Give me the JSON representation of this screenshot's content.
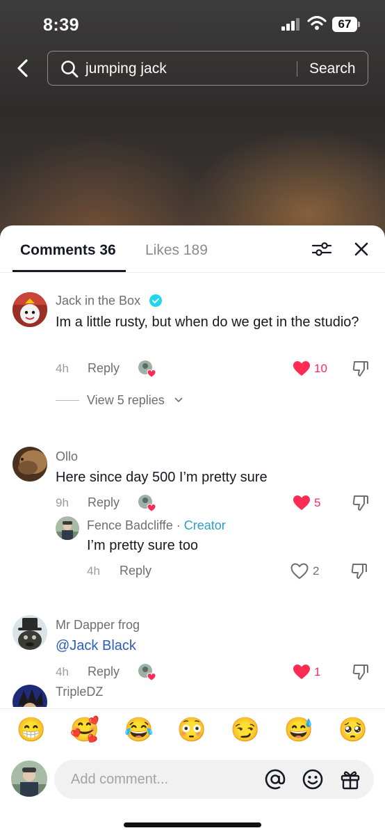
{
  "status_bar": {
    "time": "8:39",
    "battery": "67"
  },
  "search": {
    "query": "jumping jack",
    "button_label": "Search"
  },
  "tabs": {
    "comments_label": "Comments 36",
    "likes_label": "Likes 189"
  },
  "comments": [
    {
      "username": "Jack in the Box",
      "verified": true,
      "text": "Im a little rusty, but when do we get in the studio?",
      "time": "4h",
      "reply_label": "Reply",
      "likes": "10",
      "liked": true,
      "view_replies": "View 5 replies"
    },
    {
      "username": "Ollo",
      "text": "Here since day 500 I’m pretty sure",
      "time": "9h",
      "reply_label": "Reply",
      "likes": "5",
      "liked": true
    },
    {
      "username": "Fence Badcliffe",
      "separator": "·",
      "badge": "Creator",
      "text": "I’m pretty sure too",
      "time": "4h",
      "reply_label": "Reply",
      "likes": "2",
      "liked": false
    },
    {
      "username": "Mr Dapper frog",
      "text": "@Jack Black",
      "time": "4h",
      "reply_label": "Reply",
      "likes": "1",
      "liked": true
    },
    {
      "username": "TripleDZ"
    }
  ],
  "emojis": [
    "😁",
    "🥰",
    "😂",
    "😳",
    "😏",
    "😅",
    "🥺"
  ],
  "input": {
    "placeholder": "Add comment..."
  },
  "colors": {
    "accent_red": "#fe2c55",
    "creator_blue": "#2aa0c7",
    "mention_blue": "#2b5db9",
    "verified": "#20d5ec"
  }
}
